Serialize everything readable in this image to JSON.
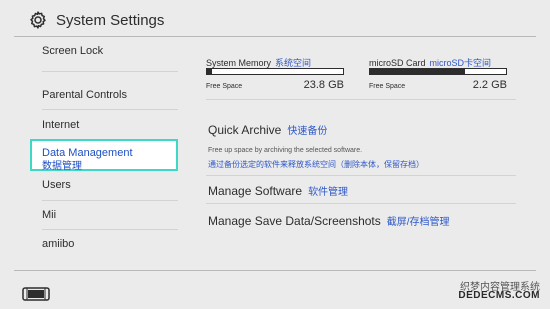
{
  "header": {
    "title": "System Settings",
    "icon": "gear-icon"
  },
  "sidebar": {
    "items": [
      {
        "label": "Screen Lock"
      },
      {
        "label": "Parental Controls"
      },
      {
        "label": "Internet"
      },
      {
        "label": "Data Management",
        "label_cn": "数据管理",
        "selected": true
      },
      {
        "label": "Users"
      },
      {
        "label": "Mii"
      },
      {
        "label": "amiibo"
      }
    ]
  },
  "storage": {
    "system_memory": {
      "label": "System Memory",
      "label_cn": "系统空间",
      "free_label": "Free Space",
      "free_value": "23.8 GB",
      "used_fraction": 0.04
    },
    "microsd": {
      "label": "microSD Card",
      "label_cn": "microSD卡空间",
      "free_label": "Free Space",
      "free_value": "2.2 GB",
      "used_fraction": 0.7
    }
  },
  "options": {
    "quick_archive": {
      "label": "Quick Archive",
      "label_cn": "快速备份",
      "desc": "Free up space by archiving the selected software.",
      "desc_cn": "通过备份选定的软件来释放系统空间（删除本体，保留存档）"
    },
    "manage_software": {
      "label": "Manage Software",
      "label_cn": "软件管理"
    },
    "manage_save": {
      "label": "Manage Save Data/Screenshots",
      "label_cn": "截屏/存档管理"
    }
  },
  "footer": {
    "icon": "console-icon"
  },
  "watermark": {
    "line1": "织梦内容管理系统",
    "line2": "DEDECMS.COM"
  },
  "colors": {
    "accent_border": "#3fd8c6",
    "link_blue": "#2f58c8",
    "selected_text": "#1e4fc2",
    "background": "#ebebeb"
  }
}
